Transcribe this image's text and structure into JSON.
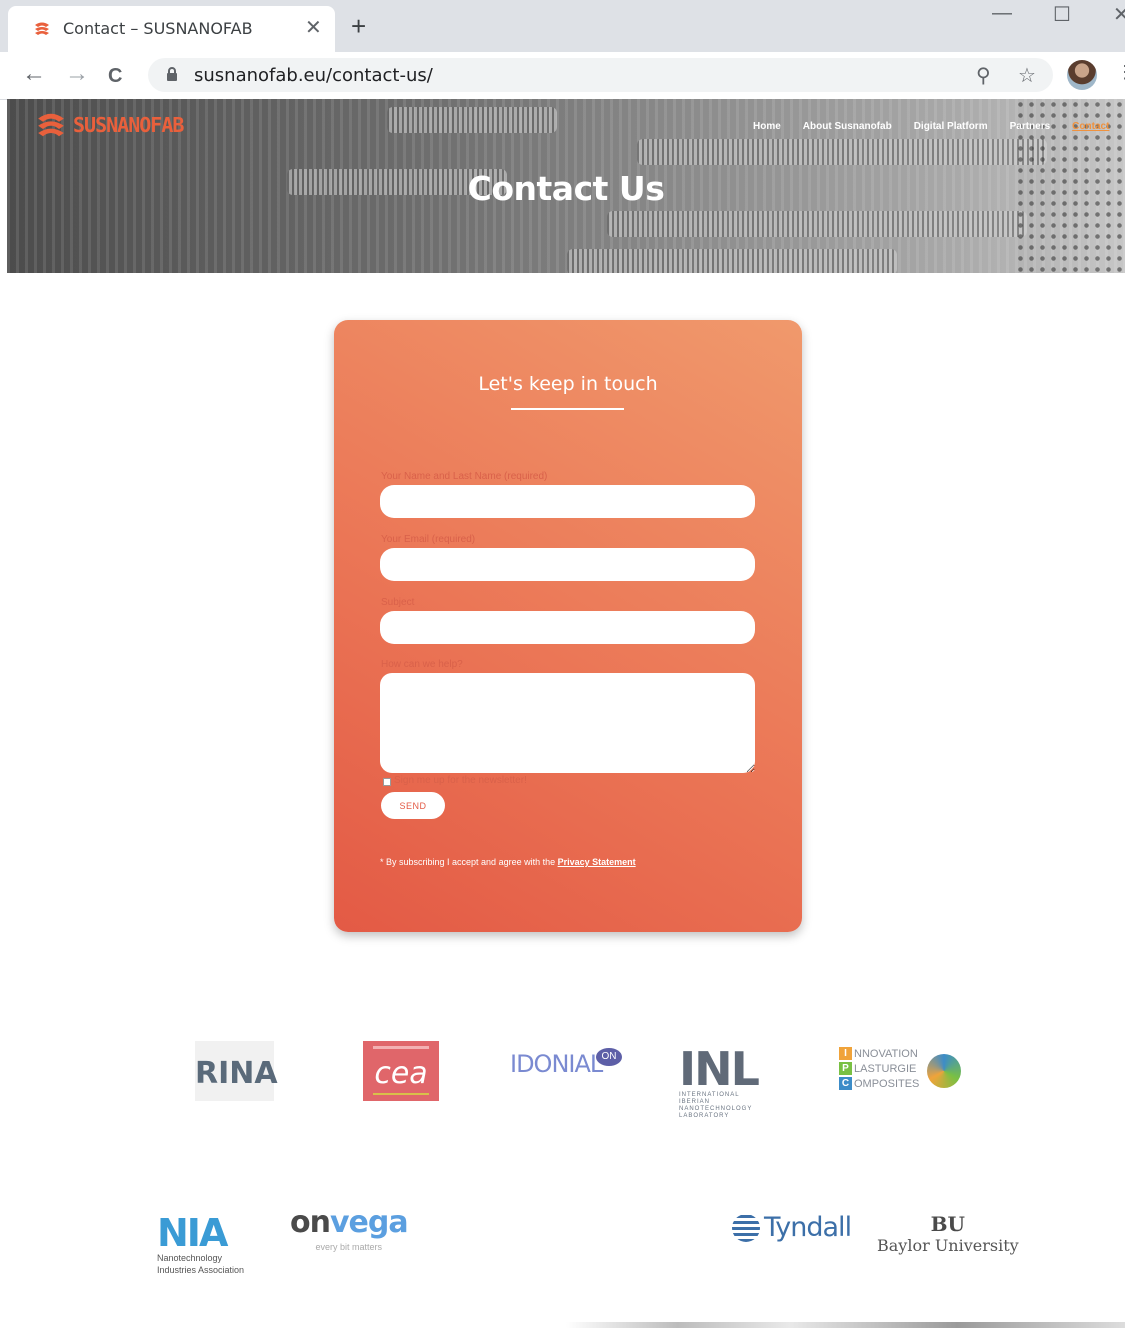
{
  "browser": {
    "tab_title": "Contact – SUSNANOFAB",
    "tab_close": "✕",
    "new_tab": "+",
    "url": "susnanofab.eu/contact-us/",
    "back": "←",
    "forward": "→",
    "reload": "C",
    "zoom_icon": "⚲",
    "bookmark_icon": "☆",
    "menu_icon": "⋮",
    "minimize": "—",
    "maximize": "☐",
    "close": "✕"
  },
  "site": {
    "logo_text": "SUSNANOFAB",
    "brand_color": "#e9603c",
    "nav": [
      "Home",
      "About Susnanofab",
      "Digital Platform",
      "Partners",
      "Contact"
    ],
    "hero_title": "Contact Us"
  },
  "form": {
    "title": "Let's keep in touch",
    "name_label": "Your Name and Last Name (required)",
    "email_label": "Your Email (required)",
    "subject_label": "Subject",
    "message_label": "How can we help?",
    "name_value": "",
    "email_value": "",
    "subject_value": "",
    "message_value": "",
    "newsletter_label": "Sign me up for the newsletter!",
    "newsletter_checked": false,
    "send_label": "SEND",
    "disclaimer_prefix": "* By subscribing I accept and agree with the ",
    "disclaimer_link": "Privacy Statement"
  },
  "partners": {
    "rina": "RINA",
    "cea": "cea",
    "idonial": "IDONIAL",
    "idonial_badge": "ON",
    "inl": "INL",
    "inl_sub": "INTERNATIONAL IBERIAN NANOTECHNOLOGY LABORATORY",
    "ipc_letters": [
      "I",
      "P",
      "C"
    ],
    "ipc_words": [
      "NNOVATION",
      "LASTURGIE",
      "OMPOSITES"
    ],
    "nia": "NIA",
    "nia_sub_1": "Nanotechnology",
    "nia_sub_2": "Industries Association",
    "onvega_on": "on",
    "onvega_vega": "vega",
    "onvega_tag": "every bit matters",
    "tyndall": "Tyndall",
    "baylor_mark": "BU",
    "baylor": "Baylor University"
  }
}
